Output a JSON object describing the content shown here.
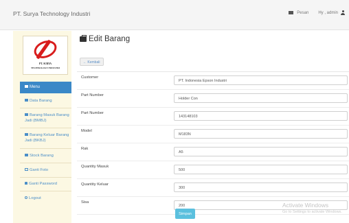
{
  "header": {
    "brand": "PT. Surya Technology Industri",
    "nav": {
      "pesan": "Pesan",
      "greeting": "Hy , admin"
    }
  },
  "logo": {
    "line1": "PT. SURYA",
    "line2": "TECHNOLOGY INDUSTRI"
  },
  "sidebar": {
    "menu_label": "Menu",
    "items": [
      {
        "label": "Data Barang",
        "icon": "list-icon"
      },
      {
        "label": "Barang Masuk Barang Jadi (BMBJ)",
        "icon": "list-icon"
      },
      {
        "label": "Barang Keluar Barang Jadi (BKBJ)",
        "icon": "list-icon"
      },
      {
        "label": "Stock Barang",
        "icon": "list-icon"
      },
      {
        "label": "Ganti Foto",
        "icon": "image-icon"
      },
      {
        "label": "Ganti Password",
        "icon": "lock-icon"
      },
      {
        "label": "Logout",
        "icon": "logout-icon"
      }
    ]
  },
  "page": {
    "title": "Edit Barang",
    "back_label": "Kembali"
  },
  "form": {
    "fields": [
      {
        "label": "Customer",
        "value": "PT. Indonesia Epson Industri"
      },
      {
        "label": "Part Number",
        "value": "Holder Con"
      },
      {
        "label": "Part Number",
        "value": "143148103"
      },
      {
        "label": "Model",
        "value": "M183N"
      },
      {
        "label": "Rak",
        "value": "A5"
      },
      {
        "label": "Quantity Masuk",
        "value": "500"
      },
      {
        "label": "Quantity Keluar",
        "value": "300"
      },
      {
        "label": "Sisa",
        "value": "200"
      }
    ],
    "save_label": "Simpan"
  },
  "watermark": {
    "title": "Activate Windows",
    "subtitle": "Go to Settings to activate Windows."
  },
  "colors": {
    "menu_active": "#3a88c7",
    "sidebar_bg": "#fcf8e3",
    "link": "#4b8ec8",
    "save_button": "#5bc0de",
    "logo_red": "#d81c1c"
  }
}
